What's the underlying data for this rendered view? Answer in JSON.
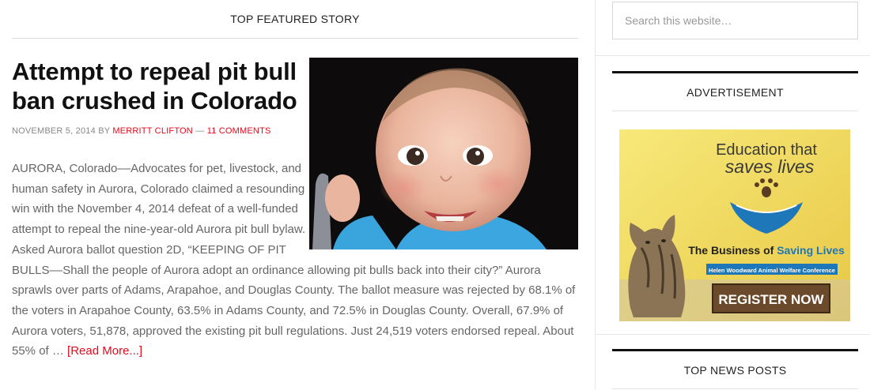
{
  "featured": {
    "section_title": "TOP FEATURED STORY",
    "headline": "Attempt to repeal pit bull ban crushed in Colorado",
    "meta": {
      "date": "NOVEMBER 5, 2014",
      "by": "BY",
      "author": "MERRITT CLIFTON",
      "sep": "—",
      "comments": "11 COMMENTS"
    },
    "excerpt": "AURORA, Colorado––Advocates for pet, livestock, and human safety in Aurora, Colorado claimed a resounding win with the November 4, 2014 defeat of a well-funded attempt to repeal the nine-year-old Aurora pit bull bylaw. Asked Aurora ballot question 2D, “KEEPING OF PIT BULLS––Shall the people of Aurora adopt an ordinance allowing pit bulls back into their city?” Aurora sprawls over parts of Adams, Arapahoe, and Douglas County.  The ballot measure was rejected by 68.1% of the voters in Arapahoe County, 63.5% in Adams County, and 72.5% in Douglas County. Overall, 67.9% of Aurora voters, 51,878, approved the existing pit bull regulations. Just 24,519 voters endorsed repeal. About 55% of …",
    "read_more": "[Read More...]"
  },
  "sidebar": {
    "search": {
      "placeholder": "Search this website…"
    },
    "ad_widget_title": "ADVERTISEMENT",
    "ad": {
      "line1": "Education that",
      "line2": "saves lives",
      "line3a": "The Business of ",
      "line3b": "Saving Lives",
      "line4": "Helen Woodward Animal Welfare Conference",
      "button": "REGISTER NOW"
    },
    "news_widget_title": "TOP NEWS POSTS"
  },
  "colors": {
    "accent": "#e5091c",
    "ad_blue": "#1e77b8",
    "ad_bg": "#f2df5a",
    "button": "#6b4a2c"
  }
}
